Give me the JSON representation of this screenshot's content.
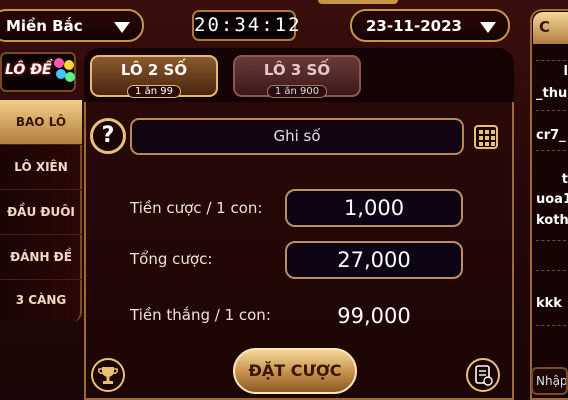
{
  "header": {
    "region": "Miền Bắc",
    "clock": "20:34:12",
    "date": "23-11-2023"
  },
  "logo": {
    "text": "LÔ ĐỀ"
  },
  "tabs": [
    {
      "label": "LÔ 2 SỐ",
      "odds": "1 ăn 99"
    },
    {
      "label": "LÔ 3 SỐ",
      "odds": "1 ăn 900"
    }
  ],
  "sidebar": {
    "items": [
      {
        "label": "BAO LÔ"
      },
      {
        "label": "LÔ XIÊN"
      },
      {
        "label": "ĐẦU ĐUÔI"
      },
      {
        "label": "ĐÁNH ĐỀ"
      },
      {
        "label": "3 CÀNG"
      }
    ]
  },
  "form": {
    "help_glyph": "?",
    "number_input_placeholder": "Ghi số",
    "bet_per_unit_label": "Tiền cược / 1 con:",
    "bet_per_unit_value": "1,000",
    "total_label": "Tổng cược:",
    "total_value": "27,000",
    "win_per_unit_label": "Tiền thắng / 1 con:",
    "win_per_unit_value": "99,000",
    "bet_button": "ĐẶT CƯỢC"
  },
  "chat": {
    "header": "C",
    "lines": [
      "l",
      "_thu",
      "cr7_",
      "t",
      "uoa1",
      "koth",
      "kkk"
    ],
    "input_placeholder": "Nhập"
  },
  "colors": {
    "accent_gold": "#e8c07a",
    "panel_bg": "#1c0505",
    "active_tab": "#8a5a2d"
  }
}
